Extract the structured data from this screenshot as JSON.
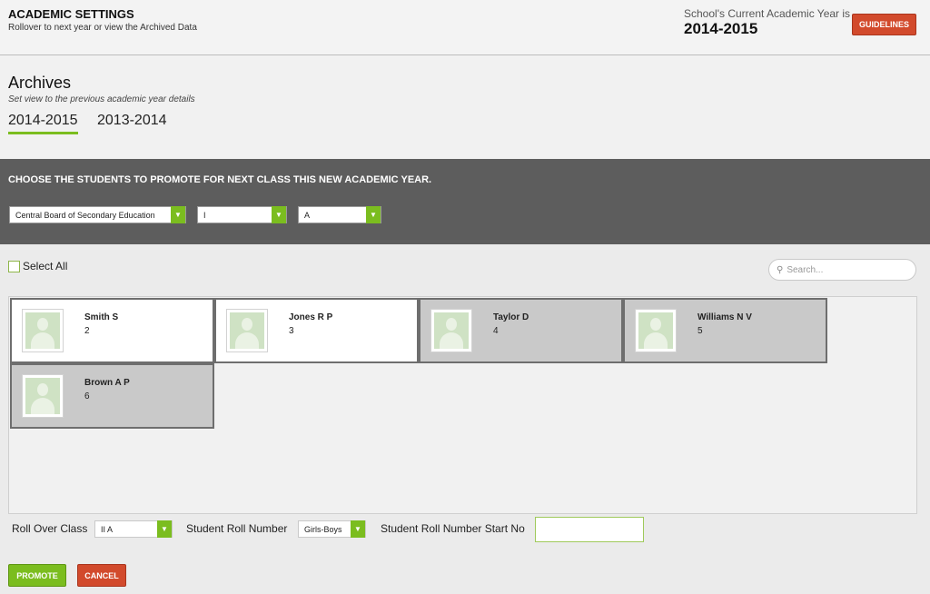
{
  "header": {
    "title": "ACADEMIC SETTINGS",
    "subtitle": "Rollover to next year or view the Archived Data",
    "academic_year_label": "School's Current Academic Year is",
    "academic_year_value": "2014-2015",
    "guidelines_label": "GUIDELINES"
  },
  "archives": {
    "title": "Archives",
    "subtitle": "Set view to the previous academic year details",
    "years": [
      {
        "label": "2014-2015",
        "active": true
      },
      {
        "label": "2013-2014",
        "active": false
      }
    ]
  },
  "promote": {
    "heading": "CHOOSE THE STUDENTS TO PROMOTE FOR NEXT CLASS THIS NEW ACADEMIC YEAR.",
    "board": "Central Board of Secondary Education",
    "class": "I",
    "section": "A"
  },
  "select_all_label": "Select All",
  "search": {
    "placeholder": "Search..."
  },
  "students": [
    {
      "name": "Smith S",
      "roll": "2",
      "selected": false
    },
    {
      "name": "Jones R P",
      "roll": "3",
      "selected": false
    },
    {
      "name": "Taylor D",
      "roll": "4",
      "selected": true
    },
    {
      "name": "Williams N V",
      "roll": "5",
      "selected": true
    },
    {
      "name": "Brown A P",
      "roll": "6",
      "selected": true
    }
  ],
  "rollover": {
    "class_label": "Roll Over Class",
    "class_value": "II A",
    "roll_number_label": "Student Roll Number",
    "roll_number_value": "Girls-Boys",
    "start_no_label": "Student Roll Number Start No",
    "start_no_value": ""
  },
  "actions": {
    "promote_label": "PROMOTE",
    "cancel_label": "CANCEL"
  },
  "colors": {
    "accent_green": "#7bbd1f",
    "accent_red": "#d24a2c",
    "band_dark": "#5d5d5d"
  }
}
